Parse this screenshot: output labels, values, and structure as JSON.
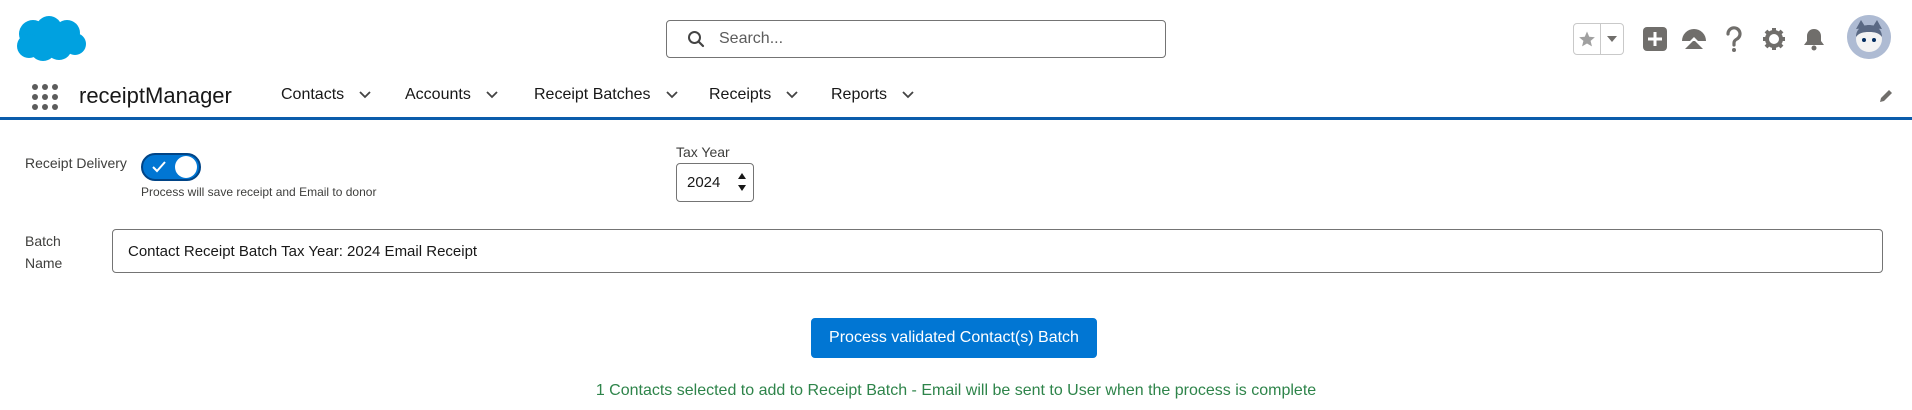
{
  "header": {
    "search": {
      "placeholder": "Search..."
    },
    "icons": [
      "salesforce-cloud-logo",
      "search-icon",
      "star-icon",
      "chevron-down-icon",
      "plus-icon",
      "trailhead-icon",
      "question-icon",
      "gear-icon",
      "bell-icon",
      "avatar"
    ]
  },
  "nav": {
    "app_name": "receiptManager",
    "items": [
      {
        "label": "Contacts"
      },
      {
        "label": "Accounts"
      },
      {
        "label": "Receipt Batches"
      },
      {
        "label": "Receipts"
      },
      {
        "label": "Reports"
      }
    ],
    "accent_color": "#0b5cab"
  },
  "form": {
    "receipt_delivery_label": "Receipt Delivery",
    "receipt_delivery_on": true,
    "receipt_delivery_help": "Process will save receipt and Email to donor",
    "tax_year_label": "Tax Year",
    "tax_year_value": "2024",
    "batch_name_label_line1": "Batch",
    "batch_name_label_line2": "Name",
    "batch_name_value": "Contact Receipt Batch Tax Year: 2024 Email Receipt"
  },
  "actions": {
    "process_label": "Process validated Contact(s) Batch",
    "button_color": "#0176d3"
  },
  "status": {
    "message": "1 Contacts selected to add to Receipt Batch - Email will be sent to User when the process is complete",
    "color": "#2e844a"
  }
}
